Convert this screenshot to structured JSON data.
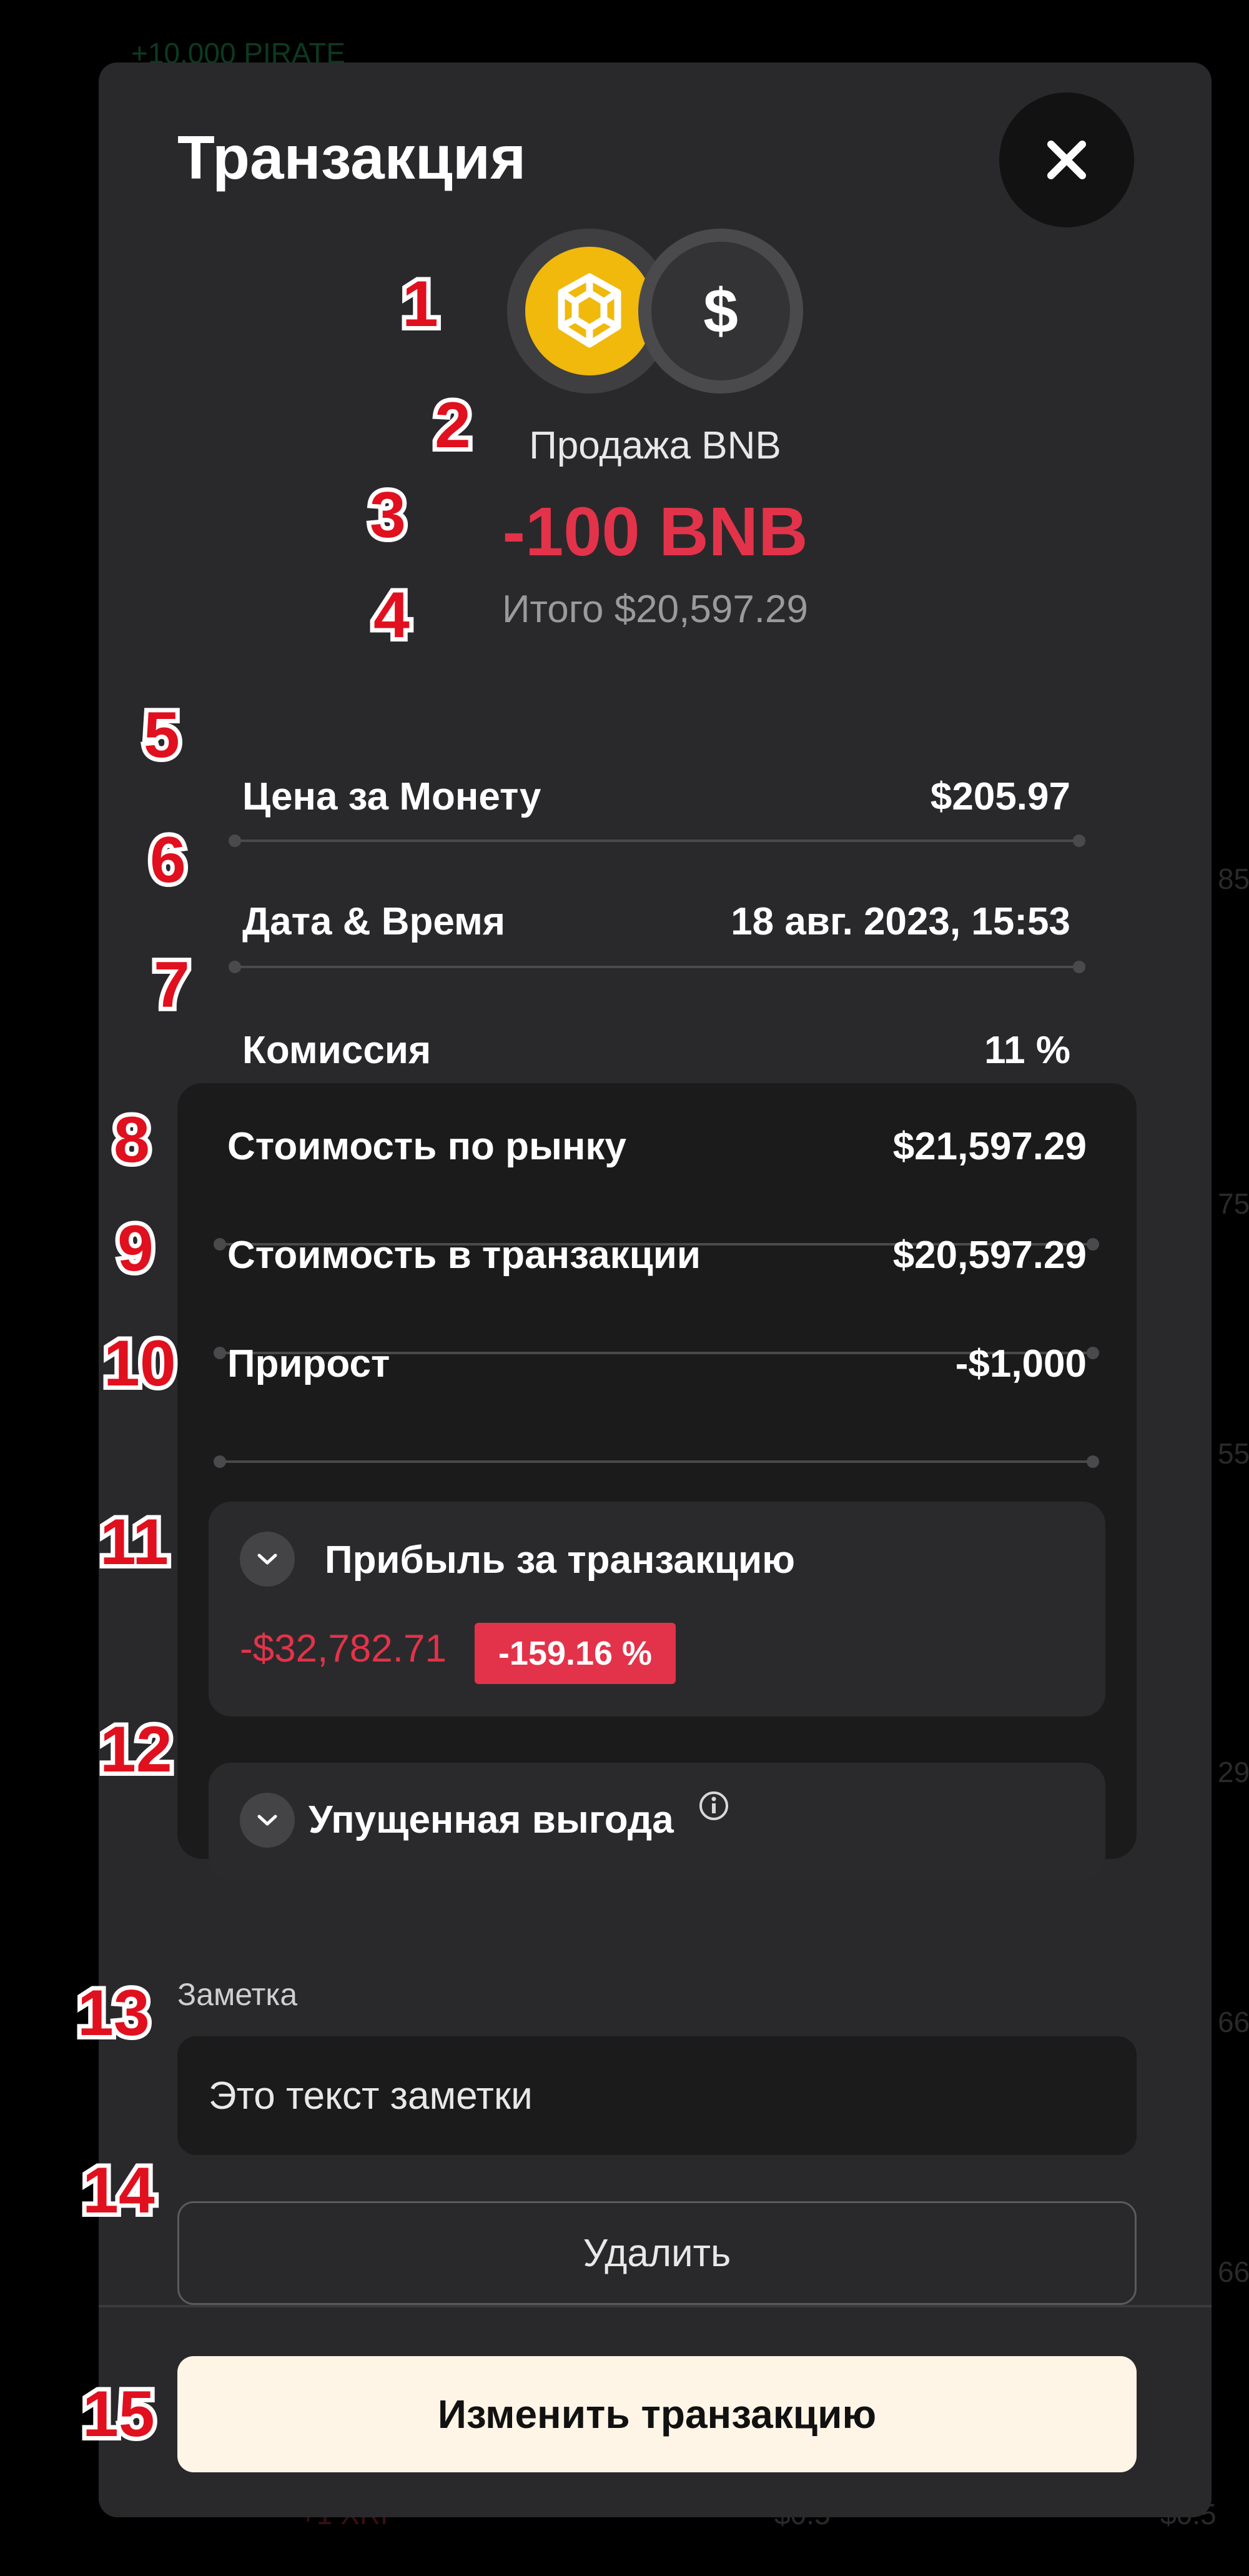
{
  "modal": {
    "title": "Транзакция",
    "subtitle": "Продажа BNB",
    "amount": "-100 BNB",
    "total": "Итого $20,597.29"
  },
  "coins": {
    "primary_icon": "bnb-icon",
    "secondary_icon": "dollar-icon",
    "secondary_symbol": "$"
  },
  "details": [
    {
      "label": "Цена за Монету",
      "value": "$205.97"
    },
    {
      "label": "Дата & Время",
      "value": "18 авг. 2023, 15:53"
    },
    {
      "label": "Комиссия",
      "value": "11 %"
    }
  ],
  "stats": [
    {
      "label": "Стоимость по рынку",
      "value": "$21,597.29"
    },
    {
      "label": "Стоимость в транзакции",
      "value": "$20,597.29"
    },
    {
      "label": "Прирост",
      "value": "-$1,000"
    }
  ],
  "profit": {
    "title": "Прибыль за транзакцию",
    "amount": "-$32,782.71",
    "percent": "-159.16 %"
  },
  "missed": {
    "title": "Упущенная выгода",
    "info_icon": "info-icon"
  },
  "note": {
    "label": "Заметка",
    "value": "Это текст заметки"
  },
  "buttons": {
    "delete": "Удалить",
    "edit": "Изменить транзакцию"
  },
  "annotations": [
    "1",
    "2",
    "3",
    "4",
    "5",
    "6",
    "7",
    "8",
    "9",
    "10",
    "11",
    "12",
    "13",
    "14",
    "15"
  ],
  "background": {
    "top_left": "+10,000 PIRATE",
    "bottom_left": "+1 XRP",
    "bottom_mid": "$0.5",
    "bottom_right": "$0.5",
    "right_edge": [
      "85",
      "75",
      "55",
      "29",
      "66",
      "66"
    ]
  },
  "colors": {
    "modal_bg": "#29292b",
    "negative": "#e3334a",
    "bnb": "#f0b90b",
    "primary_button": "#fff5e6",
    "annotation": "#e0101e"
  }
}
